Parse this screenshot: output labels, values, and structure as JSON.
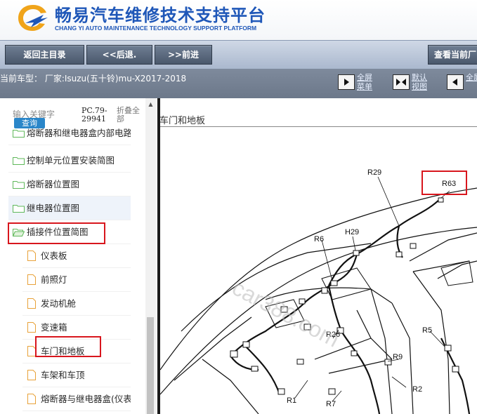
{
  "brand": {
    "title_cn": "畅易汽车维修技术支持平台",
    "title_en": "CHANG YI AUTO MAINTENANCE TECHNOLOGY SUPPORT PLATFORM",
    "color": "#1f57b8"
  },
  "toolbar": {
    "home": "返回主目录",
    "back": "<<后退.",
    "forward": ">>前进",
    "view_current": "查看当前厂"
  },
  "model": {
    "text": "当前车型： 厂家:Isuzu(五十铃)mu-X2017-2018"
  },
  "view_buttons": [
    {
      "label": "全屏菜单"
    },
    {
      "label": "默认视图"
    },
    {
      "label": "全屏"
    }
  ],
  "search": {
    "placeholder": "输入关键字",
    "button": "查询",
    "pc_code": "PC.79-29941",
    "collapse": "折叠全部"
  },
  "tree": {
    "items": [
      {
        "label": "熔断器和继电器盒内部电路",
        "type": "folder"
      },
      {
        "label": "控制单元位置安装简图",
        "type": "folder"
      },
      {
        "label": "熔断器位置图",
        "type": "folder"
      },
      {
        "label": "继电器位置图",
        "type": "folder"
      },
      {
        "label": "插接件位置简图",
        "type": "folder-open"
      },
      {
        "label": "仪表板",
        "type": "page"
      },
      {
        "label": "前照灯",
        "type": "page"
      },
      {
        "label": "发动机舱",
        "type": "page"
      },
      {
        "label": "变速箱",
        "type": "page"
      },
      {
        "label": "车门和地板",
        "type": "page"
      },
      {
        "label": "车架和车顶",
        "type": "page"
      },
      {
        "label": "熔断器与继电器盒(仪表板",
        "type": "page"
      }
    ]
  },
  "content": {
    "title": "车门和地板",
    "watermark": "car388.com",
    "labels": [
      "R29",
      "R63",
      "R6",
      "H29",
      "R26",
      "R5",
      "R9",
      "R2",
      "R1",
      "R7"
    ]
  },
  "colors": {
    "highlight": "#d8161d",
    "folder": "#5fb85a",
    "page": "#e8a23a"
  }
}
